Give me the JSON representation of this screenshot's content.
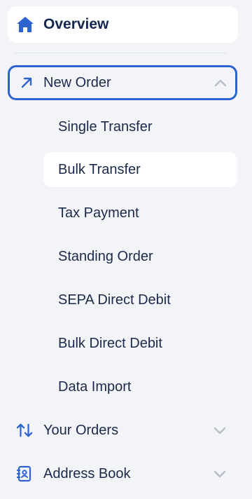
{
  "nav": {
    "overview": {
      "label": "Overview",
      "icon": "home-icon"
    },
    "new_order": {
      "label": "New Order",
      "icon": "arrow-up-right-icon",
      "expanded": true,
      "items": [
        {
          "label": "Single Transfer",
          "active": false
        },
        {
          "label": "Bulk Transfer",
          "active": true
        },
        {
          "label": "Tax Payment",
          "active": false
        },
        {
          "label": "Standing Order",
          "active": false
        },
        {
          "label": "SEPA Direct Debit",
          "active": false
        },
        {
          "label": "Bulk Direct Debit",
          "active": false
        },
        {
          "label": "Data Import",
          "active": false
        }
      ]
    },
    "your_orders": {
      "label": "Your Orders",
      "icon": "sort-arrows-icon",
      "expanded": false
    },
    "address_book": {
      "label": "Address Book",
      "icon": "address-book-icon",
      "expanded": false
    }
  },
  "colors": {
    "accent": "#2d62d1",
    "text": "#1b2a4a",
    "background": "#f3f4f7",
    "active_background": "#ffffff"
  }
}
